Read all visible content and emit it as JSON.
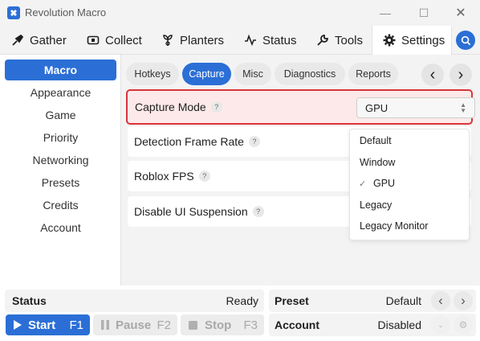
{
  "window": {
    "title": "Revolution Macro",
    "minimize": "—",
    "maximize": "☐",
    "close": "✕"
  },
  "topnav": {
    "tabs": [
      {
        "label": "Gather",
        "icon": "gather-icon"
      },
      {
        "label": "Collect",
        "icon": "collect-icon"
      },
      {
        "label": "Planters",
        "icon": "planters-icon"
      },
      {
        "label": "Status",
        "icon": "status-icon"
      },
      {
        "label": "Tools",
        "icon": "tools-icon"
      },
      {
        "label": "Settings",
        "icon": "gear-icon",
        "active": true
      }
    ],
    "search_icon": "search-icon"
  },
  "sidebar": {
    "items": [
      {
        "label": "Macro",
        "active": true
      },
      {
        "label": "Appearance"
      },
      {
        "label": "Game"
      },
      {
        "label": "Priority"
      },
      {
        "label": "Networking"
      },
      {
        "label": "Presets"
      },
      {
        "label": "Credits"
      },
      {
        "label": "Account"
      }
    ]
  },
  "subtabs": [
    {
      "label": "Hotkeys"
    },
    {
      "label": "Capture",
      "active": true
    },
    {
      "label": "Misc"
    },
    {
      "label": "Diagnostics"
    },
    {
      "label": "Reports"
    }
  ],
  "arrows": {
    "prev": "‹",
    "next": "›"
  },
  "settings": [
    {
      "label": "Capture Mode",
      "help": "?"
    },
    {
      "label": "Detection Frame Rate",
      "help": "?"
    },
    {
      "label": "Roblox FPS",
      "help": "?"
    },
    {
      "label": "Disable UI Suspension",
      "help": "?"
    }
  ],
  "capture_mode": {
    "selected": "GPU",
    "options": [
      "Default",
      "Window",
      "GPU",
      "Legacy",
      "Legacy Monitor"
    ],
    "check": "✓"
  },
  "status": {
    "status_label": "Status",
    "status_value": "Ready",
    "preset_label": "Preset",
    "preset_value": "Default",
    "account_label": "Account",
    "account_value": "Disabled"
  },
  "controls": {
    "start_label": "Start",
    "start_key": "F1",
    "pause_label": "Pause",
    "pause_key": "F2",
    "stop_label": "Stop",
    "stop_key": "F3"
  },
  "colors": {
    "accent": "#2b6fd6",
    "highlight_border": "#d9343a",
    "highlight_bg": "#fde9e9"
  }
}
